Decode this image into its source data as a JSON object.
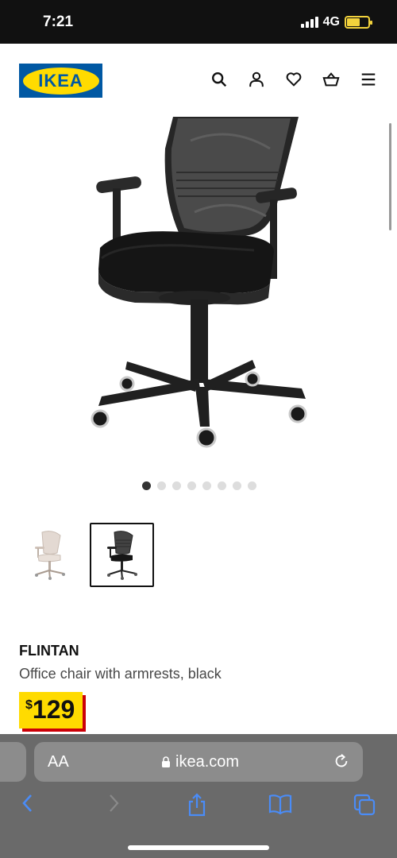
{
  "status_bar": {
    "time": "7:21",
    "network": "4G"
  },
  "header": {
    "logo_text": "IKEA",
    "icons": [
      "search-icon",
      "user-icon",
      "heart-icon",
      "basket-icon",
      "menu-icon"
    ]
  },
  "gallery": {
    "image_count": 8,
    "active_index": 0
  },
  "thumbnails": [
    {
      "color": "beige",
      "selected": false
    },
    {
      "color": "black",
      "selected": true
    }
  ],
  "product": {
    "name": "FLINTAN",
    "description": "Office chair with armrests, black",
    "price_currency": "$",
    "price_value": "129"
  },
  "browser": {
    "text_size_label": "AA",
    "url": "ikea.com"
  },
  "colors": {
    "brand_blue": "#0058a3",
    "brand_yellow": "#ffdb00",
    "price_shadow": "#cc0008",
    "browser_accent": "#4a8cf7"
  }
}
